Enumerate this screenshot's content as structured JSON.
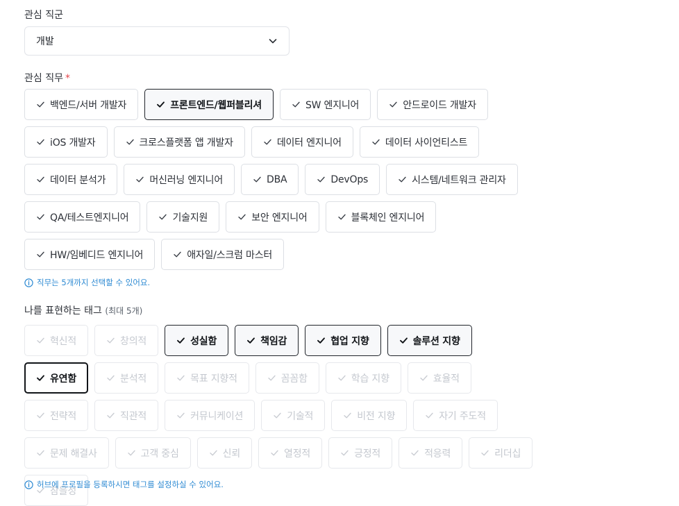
{
  "job_group": {
    "label": "관심 직군",
    "value": "개발",
    "icon": "chevron-down-icon"
  },
  "job_role": {
    "label": "관심 직무",
    "required_mark": "*",
    "chips": [
      {
        "label": "백엔드/서버 개발자",
        "state": "normal"
      },
      {
        "label": "프론트엔드/웹퍼블리셔",
        "state": "selected"
      },
      {
        "label": "SW 엔지니어",
        "state": "normal"
      },
      {
        "label": "안드로이드 개발자",
        "state": "normal"
      },
      {
        "label": "iOS 개발자",
        "state": "normal"
      },
      {
        "label": "크로스플랫폼 앱 개발자",
        "state": "normal"
      },
      {
        "label": "데이터 엔지니어",
        "state": "normal"
      },
      {
        "label": "데이터 사이언티스트",
        "state": "normal"
      },
      {
        "label": "데이터 분석가",
        "state": "normal"
      },
      {
        "label": "머신러닝 엔지니어",
        "state": "normal"
      },
      {
        "label": "DBA",
        "state": "normal"
      },
      {
        "label": "DevOps",
        "state": "normal"
      },
      {
        "label": "시스템/네트워크 관리자",
        "state": "normal"
      },
      {
        "label": "QA/테스트엔지니어",
        "state": "normal"
      },
      {
        "label": "기술지원",
        "state": "normal"
      },
      {
        "label": "보안 엔지니어",
        "state": "normal"
      },
      {
        "label": "블록체인 엔지니어",
        "state": "normal"
      },
      {
        "label": "HW/임베디드 엔지니어",
        "state": "normal"
      },
      {
        "label": "애자일/스크럼 마스터",
        "state": "normal"
      }
    ],
    "hint": "직무는 5개까지 선택할 수 있어요."
  },
  "tags": {
    "label": "나를 표현하는 태그",
    "sub_label": "(최대 5개)",
    "chips": [
      {
        "label": "혁신적",
        "state": "disabled"
      },
      {
        "label": "창의적",
        "state": "disabled"
      },
      {
        "label": "성실함",
        "state": "selected"
      },
      {
        "label": "책임감",
        "state": "selected"
      },
      {
        "label": "협업 지향",
        "state": "selected"
      },
      {
        "label": "솔루션 지향",
        "state": "selected"
      },
      {
        "label": "유연함",
        "state": "selected-focus"
      },
      {
        "label": "분석적",
        "state": "disabled"
      },
      {
        "label": "목표 지향적",
        "state": "disabled"
      },
      {
        "label": "꼼꼼함",
        "state": "disabled"
      },
      {
        "label": "학습 지향",
        "state": "disabled"
      },
      {
        "label": "효율적",
        "state": "disabled"
      },
      {
        "label": "전략적",
        "state": "disabled"
      },
      {
        "label": "직관적",
        "state": "disabled"
      },
      {
        "label": "커뮤니케이션",
        "state": "disabled"
      },
      {
        "label": "기술적",
        "state": "disabled"
      },
      {
        "label": "비전 지향",
        "state": "disabled"
      },
      {
        "label": "자기 주도적",
        "state": "disabled"
      },
      {
        "label": "문제 해결사",
        "state": "disabled"
      },
      {
        "label": "고객 중심",
        "state": "disabled"
      },
      {
        "label": "신뢰",
        "state": "disabled"
      },
      {
        "label": "열정적",
        "state": "disabled"
      },
      {
        "label": "긍정적",
        "state": "disabled"
      },
      {
        "label": "적응력",
        "state": "disabled"
      },
      {
        "label": "리더십",
        "state": "disabled"
      },
      {
        "label": "참을성",
        "state": "disabled"
      }
    ],
    "hint": "허브에 프로필을 등록하시면 태그를 설정하실 수 있어요."
  },
  "colors": {
    "required": "#e5484d",
    "hint": "#2f8bd3",
    "selected_border": "#1f2329",
    "disabled_text": "#c4c8cf"
  },
  "icons": {
    "check": "check-icon",
    "info": "info-icon"
  }
}
